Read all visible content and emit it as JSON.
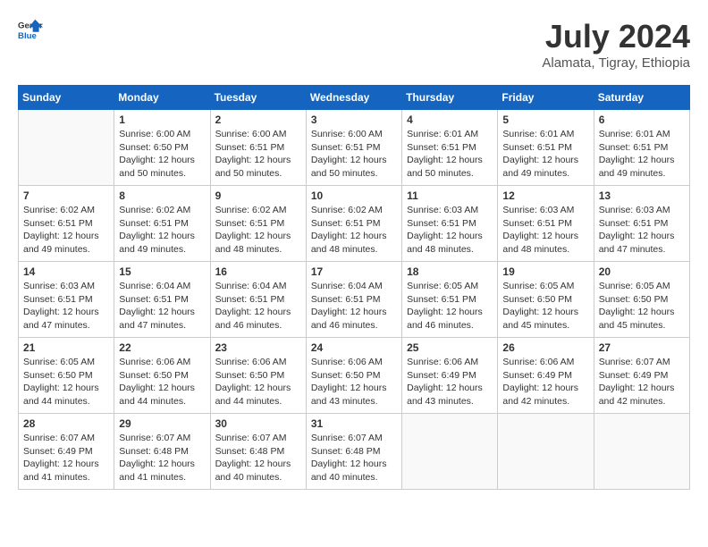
{
  "header": {
    "logo_line1": "General",
    "logo_line2": "Blue",
    "month_year": "July 2024",
    "location": "Alamata, Tigray, Ethiopia"
  },
  "weekdays": [
    "Sunday",
    "Monday",
    "Tuesday",
    "Wednesday",
    "Thursday",
    "Friday",
    "Saturday"
  ],
  "weeks": [
    [
      {
        "day": "",
        "text": ""
      },
      {
        "day": "1",
        "text": "Sunrise: 6:00 AM\nSunset: 6:50 PM\nDaylight: 12 hours\nand 50 minutes."
      },
      {
        "day": "2",
        "text": "Sunrise: 6:00 AM\nSunset: 6:51 PM\nDaylight: 12 hours\nand 50 minutes."
      },
      {
        "day": "3",
        "text": "Sunrise: 6:00 AM\nSunset: 6:51 PM\nDaylight: 12 hours\nand 50 minutes."
      },
      {
        "day": "4",
        "text": "Sunrise: 6:01 AM\nSunset: 6:51 PM\nDaylight: 12 hours\nand 50 minutes."
      },
      {
        "day": "5",
        "text": "Sunrise: 6:01 AM\nSunset: 6:51 PM\nDaylight: 12 hours\nand 49 minutes."
      },
      {
        "day": "6",
        "text": "Sunrise: 6:01 AM\nSunset: 6:51 PM\nDaylight: 12 hours\nand 49 minutes."
      }
    ],
    [
      {
        "day": "7",
        "text": "Sunrise: 6:02 AM\nSunset: 6:51 PM\nDaylight: 12 hours\nand 49 minutes."
      },
      {
        "day": "8",
        "text": "Sunrise: 6:02 AM\nSunset: 6:51 PM\nDaylight: 12 hours\nand 49 minutes."
      },
      {
        "day": "9",
        "text": "Sunrise: 6:02 AM\nSunset: 6:51 PM\nDaylight: 12 hours\nand 48 minutes."
      },
      {
        "day": "10",
        "text": "Sunrise: 6:02 AM\nSunset: 6:51 PM\nDaylight: 12 hours\nand 48 minutes."
      },
      {
        "day": "11",
        "text": "Sunrise: 6:03 AM\nSunset: 6:51 PM\nDaylight: 12 hours\nand 48 minutes."
      },
      {
        "day": "12",
        "text": "Sunrise: 6:03 AM\nSunset: 6:51 PM\nDaylight: 12 hours\nand 48 minutes."
      },
      {
        "day": "13",
        "text": "Sunrise: 6:03 AM\nSunset: 6:51 PM\nDaylight: 12 hours\nand 47 minutes."
      }
    ],
    [
      {
        "day": "14",
        "text": "Sunrise: 6:03 AM\nSunset: 6:51 PM\nDaylight: 12 hours\nand 47 minutes."
      },
      {
        "day": "15",
        "text": "Sunrise: 6:04 AM\nSunset: 6:51 PM\nDaylight: 12 hours\nand 47 minutes."
      },
      {
        "day": "16",
        "text": "Sunrise: 6:04 AM\nSunset: 6:51 PM\nDaylight: 12 hours\nand 46 minutes."
      },
      {
        "day": "17",
        "text": "Sunrise: 6:04 AM\nSunset: 6:51 PM\nDaylight: 12 hours\nand 46 minutes."
      },
      {
        "day": "18",
        "text": "Sunrise: 6:05 AM\nSunset: 6:51 PM\nDaylight: 12 hours\nand 46 minutes."
      },
      {
        "day": "19",
        "text": "Sunrise: 6:05 AM\nSunset: 6:50 PM\nDaylight: 12 hours\nand 45 minutes."
      },
      {
        "day": "20",
        "text": "Sunrise: 6:05 AM\nSunset: 6:50 PM\nDaylight: 12 hours\nand 45 minutes."
      }
    ],
    [
      {
        "day": "21",
        "text": "Sunrise: 6:05 AM\nSunset: 6:50 PM\nDaylight: 12 hours\nand 44 minutes."
      },
      {
        "day": "22",
        "text": "Sunrise: 6:06 AM\nSunset: 6:50 PM\nDaylight: 12 hours\nand 44 minutes."
      },
      {
        "day": "23",
        "text": "Sunrise: 6:06 AM\nSunset: 6:50 PM\nDaylight: 12 hours\nand 44 minutes."
      },
      {
        "day": "24",
        "text": "Sunrise: 6:06 AM\nSunset: 6:50 PM\nDaylight: 12 hours\nand 43 minutes."
      },
      {
        "day": "25",
        "text": "Sunrise: 6:06 AM\nSunset: 6:49 PM\nDaylight: 12 hours\nand 43 minutes."
      },
      {
        "day": "26",
        "text": "Sunrise: 6:06 AM\nSunset: 6:49 PM\nDaylight: 12 hours\nand 42 minutes."
      },
      {
        "day": "27",
        "text": "Sunrise: 6:07 AM\nSunset: 6:49 PM\nDaylight: 12 hours\nand 42 minutes."
      }
    ],
    [
      {
        "day": "28",
        "text": "Sunrise: 6:07 AM\nSunset: 6:49 PM\nDaylight: 12 hours\nand 41 minutes."
      },
      {
        "day": "29",
        "text": "Sunrise: 6:07 AM\nSunset: 6:48 PM\nDaylight: 12 hours\nand 41 minutes."
      },
      {
        "day": "30",
        "text": "Sunrise: 6:07 AM\nSunset: 6:48 PM\nDaylight: 12 hours\nand 40 minutes."
      },
      {
        "day": "31",
        "text": "Sunrise: 6:07 AM\nSunset: 6:48 PM\nDaylight: 12 hours\nand 40 minutes."
      },
      {
        "day": "",
        "text": ""
      },
      {
        "day": "",
        "text": ""
      },
      {
        "day": "",
        "text": ""
      }
    ]
  ]
}
